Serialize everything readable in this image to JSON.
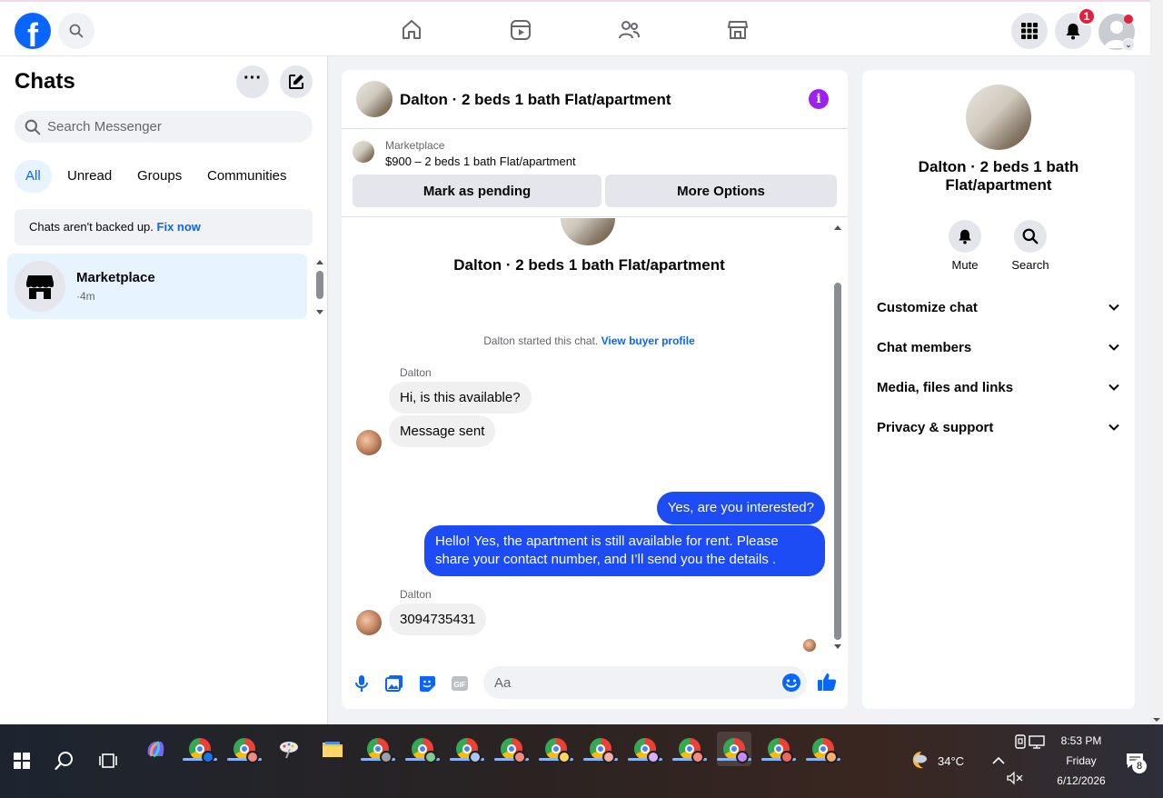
{
  "topbar": {
    "notifications_count": "1",
    "nav": [
      "home-icon",
      "reels-icon",
      "friends-icon",
      "marketplace-icon"
    ]
  },
  "sidebar": {
    "title": "Chats",
    "search_placeholder": "Search Messenger",
    "filters": [
      "All",
      "Unread",
      "Groups",
      "Communities"
    ],
    "backup_text": "Chats aren't backed up.",
    "backup_link": "Fix now",
    "chats": [
      {
        "name": "Marketplace",
        "time": "·4m"
      }
    ]
  },
  "conversation": {
    "title": "Dalton · 2 beds 1 bath Flat/apartment",
    "marketplace_label": "Marketplace",
    "listing": "$900 – 2 beds 1 bath Flat/apartment",
    "btn_pending": "Mark as pending",
    "btn_more": "More Options",
    "intro_title": "Dalton · 2 beds 1 bath Flat/apartment",
    "started_text": "Dalton started this chat.",
    "started_link": "View buyer profile",
    "messages": [
      {
        "sender": "Dalton",
        "text": "Hi, is this available?",
        "outgoing": false
      },
      {
        "sender": "",
        "text": "Message sent",
        "outgoing": false
      },
      {
        "sender": "",
        "text": "Yes, are you interested?",
        "outgoing": true
      },
      {
        "sender": "",
        "text": "Hello! Yes, the apartment is still available for rent. Please share your contact number, and I’ll send you the details .",
        "outgoing": true
      },
      {
        "sender": "Dalton",
        "text": "3094735431",
        "outgoing": false
      }
    ],
    "compose_placeholder": "Aa"
  },
  "details": {
    "title": "Dalton · 2 beds 1 bath Flat/apartment",
    "actions": [
      "Mute",
      "Search"
    ],
    "sections": [
      "Customize chat",
      "Chat members",
      "Media, files and links",
      "Privacy & support"
    ]
  },
  "taskbar": {
    "weather": "34°C",
    "time": "8:53 PM",
    "day": "Friday",
    "date": "6/12/2026",
    "notif_count": "8"
  },
  "colors": {
    "brand": "#0866ff",
    "outgoing_bubble": "#1d4cf5",
    "incoming_bubble": "#f0f0f0",
    "badge": "#e41e3f"
  }
}
